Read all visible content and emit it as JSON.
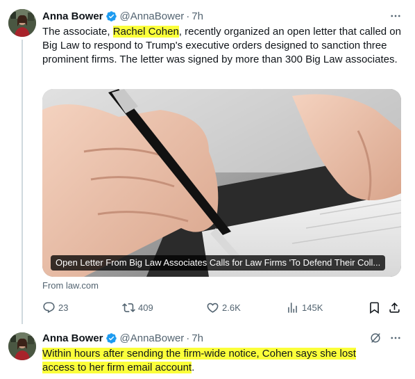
{
  "tweets": [
    {
      "author_name": "Anna Bower",
      "handle": "@AnnaBower",
      "separator": "·",
      "time": "7h",
      "text_before": "The associate, ",
      "text_highlight": "Rachel Cohen",
      "text_after": ", recently organized an open letter that called on Big Law to respond to Trump's executive orders designed to sanction three prominent firms. The letter was signed by more than 300 Big Law associates.",
      "card": {
        "title": "Open Letter From Big Law Associates Calls for Law Firms 'To Defend Their Coll...",
        "source": "From law.com"
      },
      "stats": {
        "replies": "23",
        "reposts": "409",
        "likes": "2.6K",
        "views": "145K"
      }
    },
    {
      "author_name": "Anna Bower",
      "handle": "@AnnaBower",
      "separator": "·",
      "time": "7h",
      "text_highlight_1": "Within hours after sending the firm-wide notice, Cohen says she lost",
      "text_highlight_2": "access to her firm email account",
      "text_after": "."
    }
  ],
  "icons": {
    "verified": "verified-badge-icon",
    "more": "more-options-icon",
    "grok": "grok-icon",
    "reply": "reply-icon",
    "repost": "repost-icon",
    "like": "heart-icon",
    "views": "views-icon",
    "bookmark": "bookmark-icon",
    "share": "share-icon"
  },
  "colors": {
    "verified": "#1d9bf0",
    "highlight": "#fbff3a",
    "secondary_text": "#536471",
    "thread_line": "#cfd9de"
  }
}
